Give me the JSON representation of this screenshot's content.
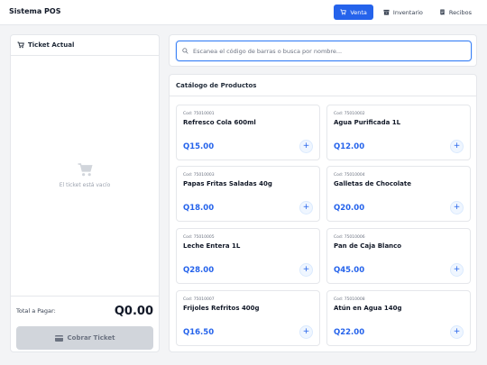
{
  "app": {
    "title": "Sistema POS"
  },
  "nav": [
    {
      "label": "Venta",
      "icon": "cart-icon",
      "active": true
    },
    {
      "label": "Inventario",
      "icon": "box-icon",
      "active": false
    },
    {
      "label": "Recibos",
      "icon": "receipt-icon",
      "active": false
    }
  ],
  "ticket": {
    "title": "Ticket Actual",
    "empty_text": "El ticket está vacío",
    "total_label": "Total a Pagar:",
    "total_value": "Q0.00",
    "pay_label": "Cobrar Ticket"
  },
  "search": {
    "placeholder": "Escanea el código de barras o busca por nombre...",
    "value": ""
  },
  "catalog": {
    "title": "Catálogo de Productos",
    "add_label": "+",
    "products": [
      {
        "code": "Cod: 75010001",
        "name": "Refresco Cola 600ml",
        "price": "Q15.00"
      },
      {
        "code": "Cod: 75010002",
        "name": "Agua Purificada 1L",
        "price": "Q12.00"
      },
      {
        "code": "Cod: 75010003",
        "name": "Papas Fritas Saladas 40g",
        "price": "Q18.00"
      },
      {
        "code": "Cod: 75010004",
        "name": "Galletas de Chocolate",
        "price": "Q20.00"
      },
      {
        "code": "Cod: 75010005",
        "name": "Leche Entera 1L",
        "price": "Q28.00"
      },
      {
        "code": "Cod: 75010006",
        "name": "Pan de Caja Blanco",
        "price": "Q45.00"
      },
      {
        "code": "Cod: 75010007",
        "name": "Frijoles Refritos 400g",
        "price": "Q16.50"
      },
      {
        "code": "Cod: 75010008",
        "name": "Atún en Agua 140g",
        "price": "Q22.00"
      }
    ]
  },
  "colors": {
    "accent": "#2563eb",
    "background": "#f3f4f6",
    "disabled": "#d1d5db"
  }
}
